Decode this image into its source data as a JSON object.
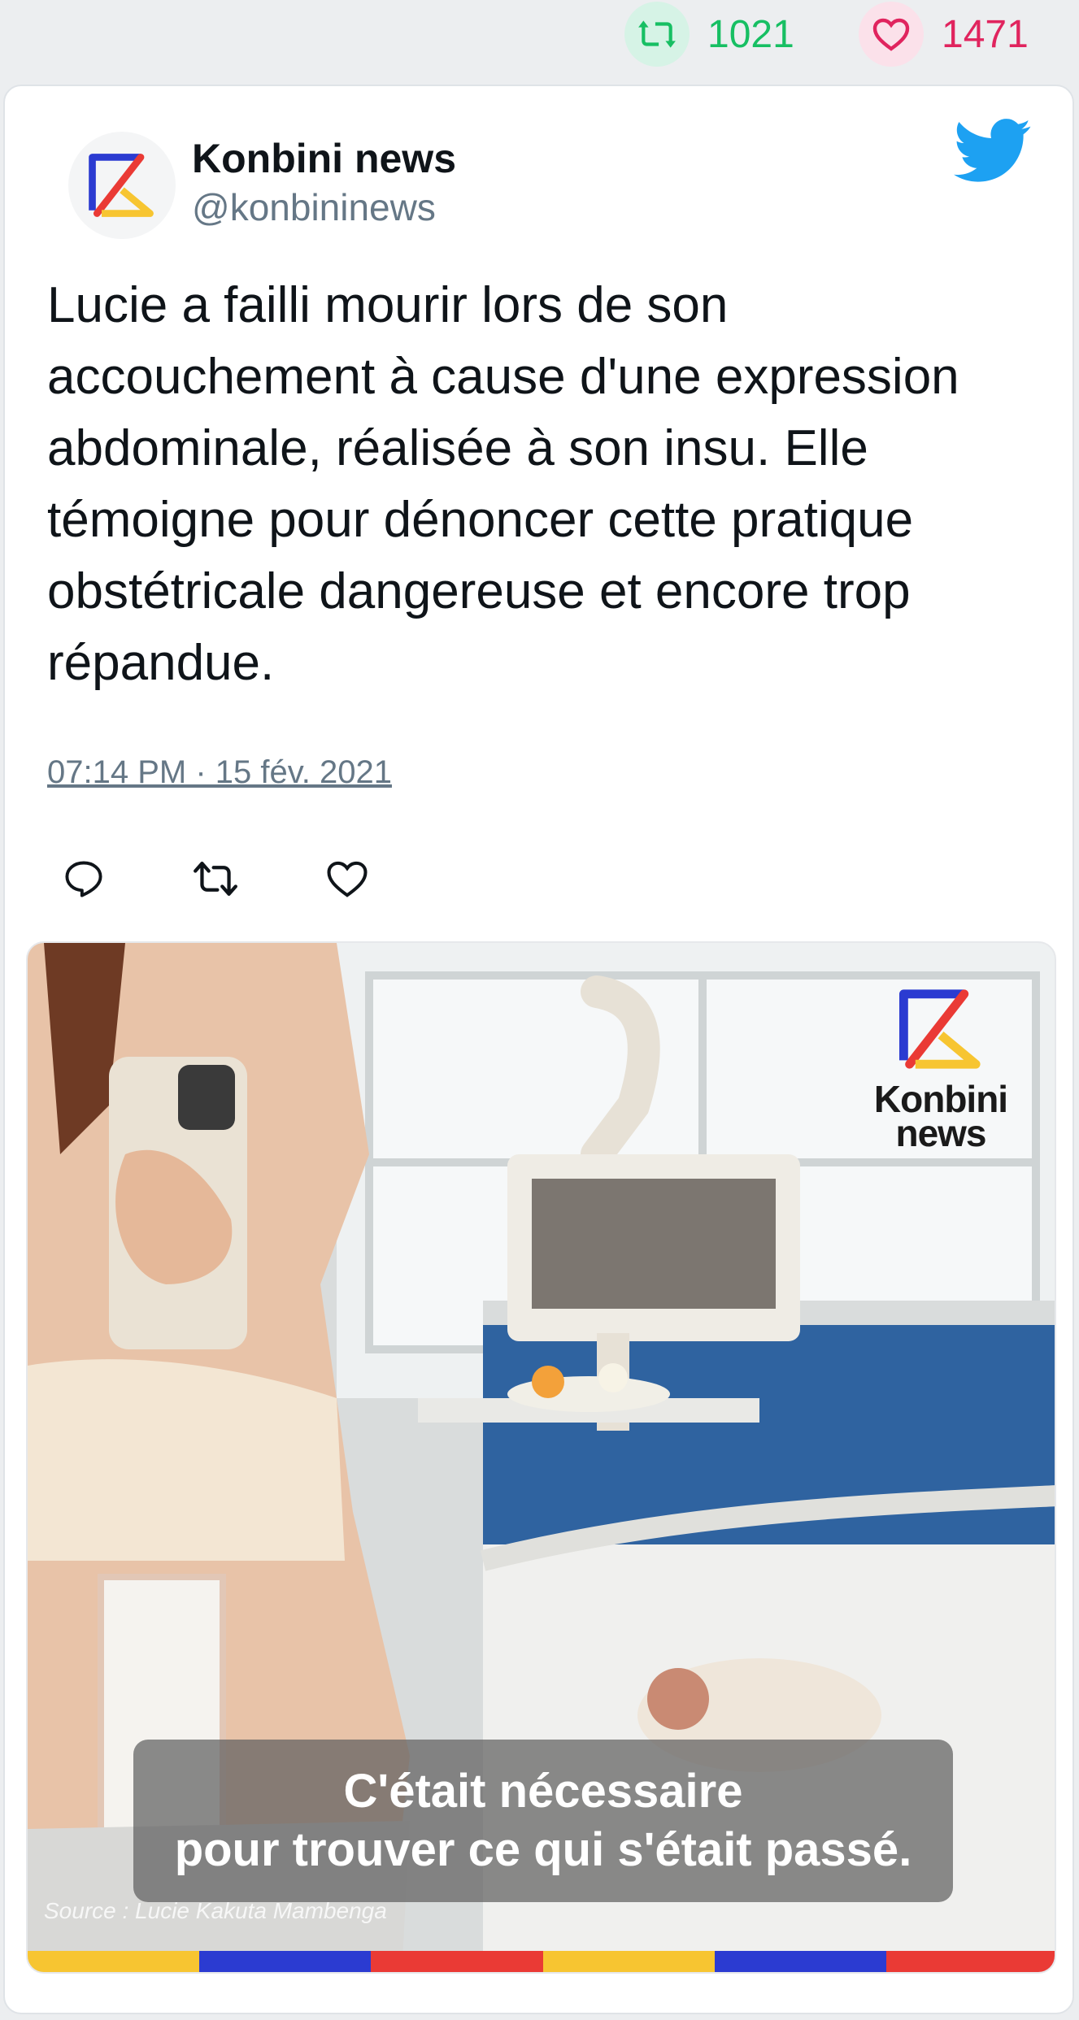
{
  "stats": {
    "retweets": "1021",
    "likes": "1471",
    "retweet_icon": "retweet-icon",
    "like_icon": "heart-icon"
  },
  "tweet": {
    "author_name": "Konbini news",
    "author_handle": "@konbininews",
    "text": "Lucie a failli mourir lors de son\naccouchement à cause d'une expression\nabdominale, réalisée à son insu. Elle\ntémoigne pour dénoncer cette pratique\nobstétricale dangereuse et encore trop\nrépandue.",
    "timestamp": "07:14 PM · 15 fév. 2021"
  },
  "media": {
    "brand_line1": "Konbini",
    "brand_line2": "news",
    "caption_line1": "C'était nécessaire",
    "caption_line2": "pour trouver ce qui s'était passé.",
    "source": "Source : Lucie Kakuta Mambenga"
  },
  "colors": {
    "retweet": "#17bf63",
    "like": "#e0245e",
    "twitter_blue": "#1da1f2",
    "stripe": [
      "#f7c531",
      "#2b3bd1",
      "#ea3a35",
      "#f7c531",
      "#2b3bd1",
      "#ea3a35"
    ]
  }
}
